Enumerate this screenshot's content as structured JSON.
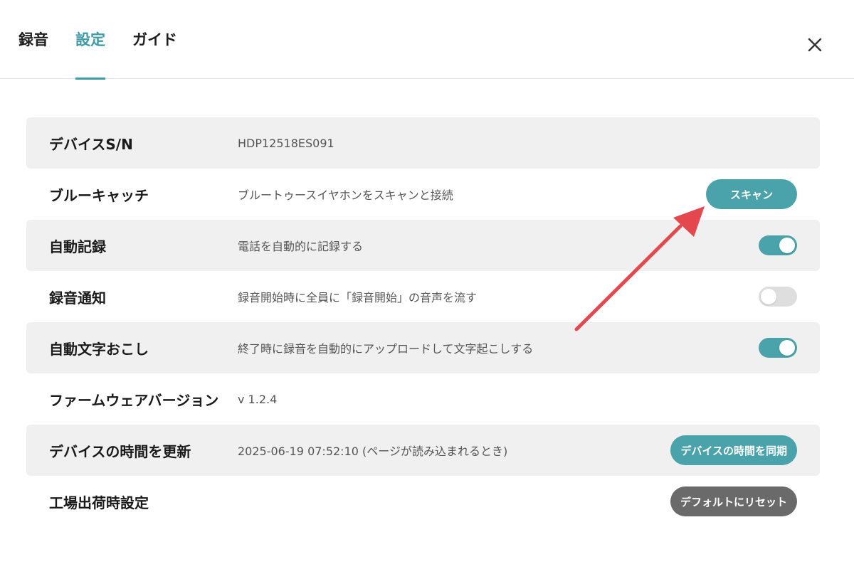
{
  "tabs": [
    {
      "label": "録音",
      "active": false
    },
    {
      "label": "設定",
      "active": true
    },
    {
      "label": "ガイド",
      "active": false
    }
  ],
  "close_icon": "close-icon",
  "colors": {
    "accent": "#4aa3ab",
    "tab_active": "#3f9ba6",
    "reset_button": "#6a6a6a",
    "annotation_arrow": "#e5474f"
  },
  "settings": {
    "device_sn": {
      "label": "デバイスS/N",
      "value": "HDP12518ES091"
    },
    "blue_catch": {
      "label": "ブルーキャッチ",
      "value": "ブルートゥースイヤホンをスキャンと接続",
      "button": "スキャン"
    },
    "auto_record": {
      "label": "自動記録",
      "value": "電話を自動的に記録する",
      "toggle": true
    },
    "record_notify": {
      "label": "録音通知",
      "value": "録音開始時に全員に「録音開始」の音声を流す",
      "toggle": false
    },
    "auto_transcribe": {
      "label": "自動文字おこし",
      "value": "終了時に録音を自動的にアップロードして文字起こしする",
      "toggle": true
    },
    "firmware": {
      "label": "ファームウェアバージョン",
      "value": "v 1.2.4"
    },
    "update_time": {
      "label": "デバイスの時間を更新",
      "value": "2025-06-19 07:52:10 (ページが読み込まれるとき)",
      "button": "デバイスの時間を同期"
    },
    "factory_reset": {
      "label": "工場出荷時設定",
      "button": "デフォルトにリセット"
    }
  }
}
